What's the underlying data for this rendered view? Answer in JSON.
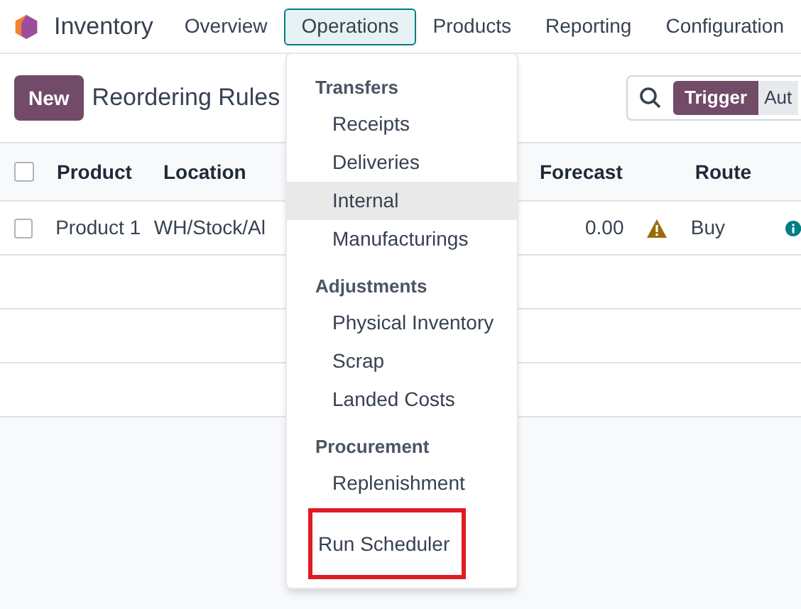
{
  "app": {
    "name": "Inventory"
  },
  "menu": [
    {
      "label": "Overview",
      "selected": false
    },
    {
      "label": "Operations",
      "selected": true
    },
    {
      "label": "Products",
      "selected": false
    },
    {
      "label": "Reporting",
      "selected": false
    },
    {
      "label": "Configuration",
      "selected": false
    }
  ],
  "control_panel": {
    "new_button": "New",
    "title": "Reordering Rules",
    "search": {
      "facet": "Trigger",
      "facet_2": "Aut"
    }
  },
  "table": {
    "columns": [
      "Product",
      "Location",
      "Forecast",
      "Route"
    ],
    "rows": [
      {
        "selected": false,
        "product": "Product 1",
        "location": "WH/Stock/Al",
        "forecast": "0.00",
        "warning": true,
        "route": "Buy"
      }
    ],
    "select_all": {
      "checked": false
    }
  },
  "dropdown": {
    "sections": [
      {
        "header": "Transfers",
        "items": [
          {
            "label": "Receipts",
            "selected": false
          },
          {
            "label": "Deliveries",
            "selected": false
          },
          {
            "label": "Internal",
            "selected": true
          },
          {
            "label": "Manufacturings",
            "selected": false
          }
        ]
      },
      {
        "header": "Adjustments",
        "items": [
          {
            "label": "Physical Inventory",
            "selected": false
          },
          {
            "label": "Scrap",
            "selected": false
          },
          {
            "label": "Landed Costs",
            "selected": false
          }
        ]
      },
      {
        "header": "Procurement",
        "items": [
          {
            "label": "Replenishment",
            "selected": false
          }
        ]
      }
    ],
    "footer_item": {
      "label": "Run Scheduler",
      "selected": false,
      "highlighted": true
    }
  }
}
